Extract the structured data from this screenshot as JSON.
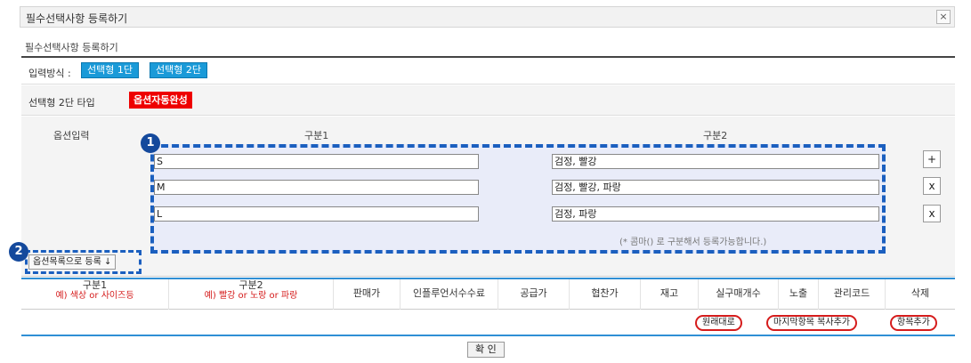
{
  "window": {
    "title": "필수선택사항 등록하기",
    "close_label": "×"
  },
  "breadcrumb": "필수선택사항 등록하기",
  "method": {
    "label": "입력방식 :",
    "option1": "선택형 1단",
    "option2": "선택형 2단"
  },
  "type_row": {
    "label": "선택형 2단 타입",
    "auto_button": "옵션자동완성"
  },
  "options": {
    "header_input": "옵션입력",
    "header_cat1": "구분1",
    "header_cat2": "구분2",
    "rows": [
      {
        "cat1": "S",
        "cat2": "검정, 빨강",
        "action": "+"
      },
      {
        "cat1": "M",
        "cat2": "검정, 빨강, 파랑",
        "action": "x"
      },
      {
        "cat1": "L",
        "cat2": "검정, 파랑",
        "action": "x"
      }
    ],
    "note": "(* 콤마() 로 구분해서 등록가능합니다.)",
    "register_button": "옵션목록으로 등록 ↓"
  },
  "badges": {
    "one": "1",
    "two": "2"
  },
  "table": {
    "columns": [
      {
        "title": "구분1",
        "sub": "예) 색상 or 사이즈등"
      },
      {
        "title": "구분2",
        "sub": "예) 빨강 or 노랑 or 파랑"
      },
      {
        "title": "판매가"
      },
      {
        "title": "인플루언서수수료"
      },
      {
        "title": "공급가"
      },
      {
        "title": "협찬가"
      },
      {
        "title": "재고"
      },
      {
        "title": "실구매개수"
      },
      {
        "title": "노출"
      },
      {
        "title": "관리코드"
      },
      {
        "title": "삭제"
      }
    ]
  },
  "actions": {
    "reset": "원래대로",
    "copy_last": "마지막항목 복사추가",
    "add_item": "항목추가"
  },
  "confirm": "확 인",
  "colors": {
    "accent_blue": "#1a9ad8",
    "alert_red": "#ee0000",
    "callout_blue": "#1b5fbf"
  }
}
